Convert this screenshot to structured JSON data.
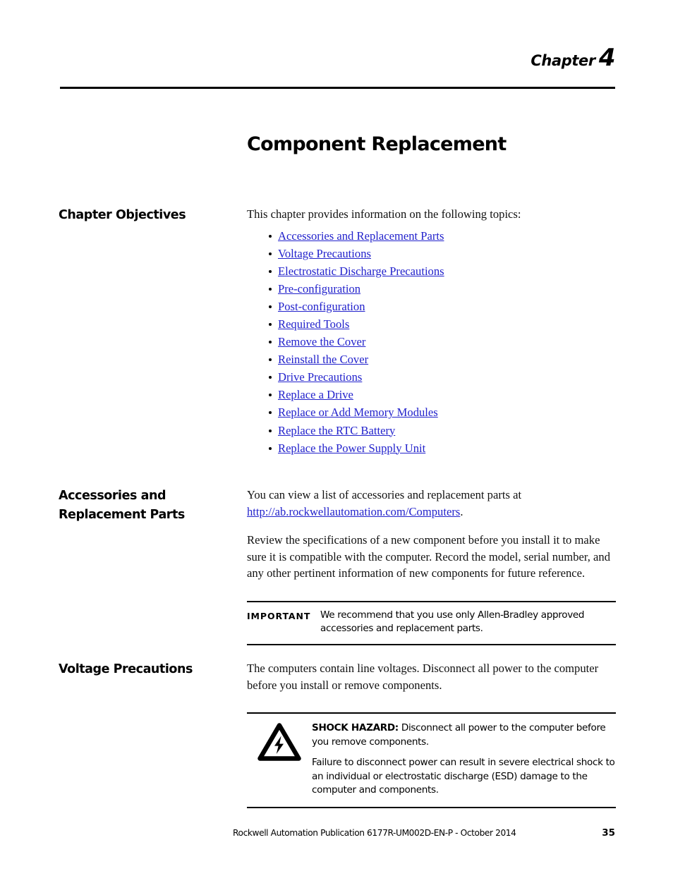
{
  "header": {
    "chapter_word": "Chapter",
    "chapter_number": "4"
  },
  "page_title": "Component Replacement",
  "sections": {
    "objectives": {
      "heading": "Chapter Objectives",
      "intro": "This chapter provides information on the following topics:",
      "links": [
        "Accessories and Replacement Parts",
        "Voltage Precautions",
        "Electrostatic Discharge Precautions",
        "Pre-configuration",
        "Post-configuration",
        "Required Tools",
        "Remove the Cover",
        "Reinstall the Cover",
        "Drive Precautions",
        "Replace a Drive",
        "Replace or Add Memory Modules",
        "Replace the RTC Battery",
        "Replace the Power Supply Unit"
      ]
    },
    "accessories": {
      "heading": "Accessories and Replacement Parts",
      "paragraph1_before_link": "You can view a list of accessories and replacement parts at ",
      "paragraph1_link": "http://ab.rockwellautomation.com/Computers",
      "paragraph1_after_link": ".",
      "paragraph2": "Review the specifications of a new component before you install it to make sure it is compatible with the computer. Record the model, serial number, and any other pertinent information of new components for future reference.",
      "important": {
        "label": "IMPORTANT",
        "text": "We recommend that you use only Allen-Bradley approved accessories and replacement parts."
      }
    },
    "voltage": {
      "heading": "Voltage Precautions",
      "paragraph1": "The computers contain line voltages. Disconnect all power to the computer before you install or remove components.",
      "hazard": {
        "icon": "shock-hazard-icon",
        "title": "SHOCK HAZARD:",
        "line1": " Disconnect all power to the computer before you remove components.",
        "line2": "Failure to disconnect power can result in severe electrical shock to an individual or electrostatic discharge (ESD) damage to the computer and components."
      }
    }
  },
  "footer": {
    "publication": "Rockwell Automation Publication 6177R-UM002D-EN-P - October 2014",
    "page_number": "35"
  },
  "colors": {
    "link": "#2222cc",
    "text": "#000000"
  }
}
